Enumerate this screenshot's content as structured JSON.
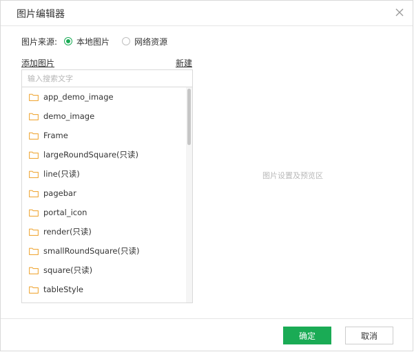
{
  "dialog": {
    "title": "图片编辑器",
    "close_icon": "close-icon"
  },
  "source": {
    "label": "图片来源:",
    "options": [
      {
        "label": "本地图片",
        "checked": true
      },
      {
        "label": "网络资源",
        "checked": false
      }
    ]
  },
  "links": {
    "add_image": "添加图片",
    "new": "新建"
  },
  "search": {
    "value": "",
    "placeholder": "输入搜索文字"
  },
  "folders": [
    {
      "label": "app_demo_image"
    },
    {
      "label": "demo_image"
    },
    {
      "label": "Frame"
    },
    {
      "label": "largeRoundSquare(只读)"
    },
    {
      "label": "line(只读)"
    },
    {
      "label": "pagebar"
    },
    {
      "label": "portal_icon"
    },
    {
      "label": "render(只读)"
    },
    {
      "label": "smallRoundSquare(只读)"
    },
    {
      "label": "square(只读)"
    },
    {
      "label": "tableStyle"
    }
  ],
  "preview": {
    "placeholder": "图片设置及预览区"
  },
  "footer": {
    "ok_label": "确定",
    "cancel_label": "取消"
  },
  "colors": {
    "accent": "#1aab55",
    "folder": "#f0a93b",
    "border": "#d9d9d9"
  }
}
